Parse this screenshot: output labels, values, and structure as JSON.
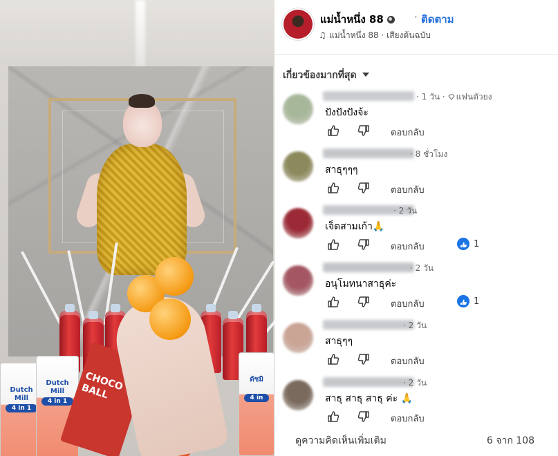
{
  "colors": {
    "accent": "#216fdb",
    "text": "#050505",
    "muted": "#65676b",
    "like": "#1b74e4"
  },
  "photo": {
    "product_brand": "Dutch Mill",
    "product_variant": "4 in 1",
    "snack_text": "CHOCO BALL",
    "carton_right_text": "ดัชมิ",
    "carton_right_sub": "4 in"
  },
  "header": {
    "author": "แม่น้ำหนึ่ง 88",
    "separator": "·",
    "follow_label": "ติดตาม",
    "audio_icon": "music-note-icon",
    "audio_text": "แม่น้ำหนึ่ง 88 · เสียงต้นฉบับ"
  },
  "sort": {
    "label": "เกี่ยวข้องมากที่สุด"
  },
  "comments": [
    {
      "meta": "· 1 วัน ·",
      "badge": "แฟนตัวยง",
      "text": "ปังปังปังจ้ะ",
      "reply": "ตอบกลับ",
      "reactions": "",
      "avatar_color": "#a7b89a",
      "name_color": "#c9cbcf"
    },
    {
      "meta": "· 8 ชั่วโมง",
      "badge": "",
      "text": "สาธุๆๆๆ",
      "reply": "ตอบกลับ",
      "reactions": "",
      "avatar_color": "#8c8a5c",
      "name_color": "#c4c6ca"
    },
    {
      "meta": "· 2 วัน",
      "badge": "",
      "text": "เจ็ดสามเก้า🙏",
      "reply": "ตอบกลับ",
      "reactions": "1",
      "avatar_color": "#9c2a36",
      "name_color": "#c6c8cc"
    },
    {
      "meta": "· 2 วัน",
      "badge": "",
      "text": "อนุโมทนาสาธุค่ะ",
      "reply": "ตอบกลับ",
      "reactions": "1",
      "avatar_color": "#a45662",
      "name_color": "#c2c4c8"
    },
    {
      "meta": "· 2 วัน",
      "badge": "",
      "text": "สาธุๆๆ",
      "reply": "ตอบกลับ",
      "reactions": "",
      "avatar_color": "#caa494",
      "name_color": "#c8cace"
    },
    {
      "meta": "· 2 วัน",
      "badge": "",
      "text": "สาธุ สาธุ สาธุ ค่ะ 🙏",
      "reply": "ตอบกลับ",
      "reactions": "",
      "avatar_color": "#7a6a5e",
      "name_color": "#c5c7cb"
    }
  ],
  "footer": {
    "more_label": "ดูความคิดเห็นเพิ่มเติม",
    "count_label": "6 จาก 108"
  }
}
